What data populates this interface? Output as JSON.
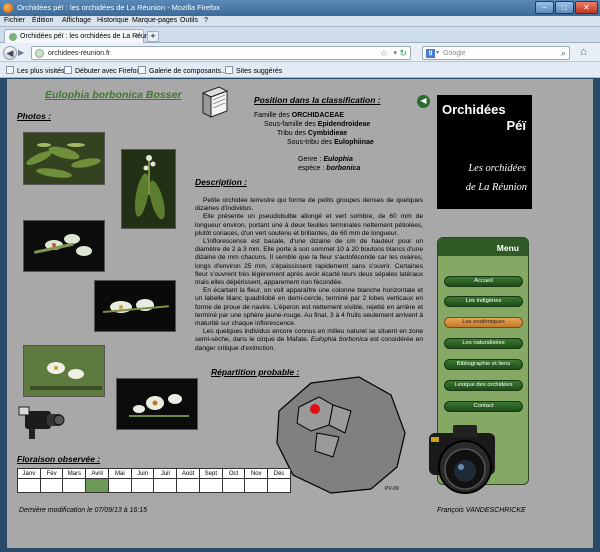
{
  "window": {
    "title": "Orchidées péï : les orchidées de La Réunion - Mozilla Firefox",
    "min": "‒",
    "max": "□",
    "close": "✕"
  },
  "menubar": [
    "Fichier",
    "Édition",
    "Affichage",
    "Historique",
    "Marque-pages",
    "Outils",
    "?"
  ],
  "tab": {
    "title": "Orchidées péï : les orchidées de La Réuni...",
    "close": "×",
    "new": "+"
  },
  "nav": {
    "back": "◀",
    "forward": "▶",
    "url": "orchidees-reunion.fr",
    "search_placeholder": "Google",
    "search_engine": "g",
    "home": "⌂"
  },
  "bookmarks": [
    "Les plus visités",
    "Débuter avec Firefox",
    "Galerie de composants...",
    "Sites suggérés"
  ],
  "page": {
    "latin_name": "Eulophia borbonica Bosser",
    "photos_heading": "Photos :",
    "classification_heading": "Position dans la classification :",
    "classification": {
      "famille_label": "Famille des",
      "famille": "ORCHIDACEAE",
      "sous_famille_label": "Sous-famille des",
      "sous_famille": "Epidendroideae",
      "tribu_label": "Tribu des",
      "tribu": "Cymbidieae",
      "sous_tribu_label": "Sous-tribu des",
      "sous_tribu": "Eulophiinae",
      "genre_label": "Genre :",
      "genre": "Eulophia",
      "espece_label": "espèce :",
      "espece": "borbonica"
    },
    "description_heading": "Description :",
    "description": [
      "Petite orchidée terrestre qui forme de petits groupes denses de quelques dizaines d'individus.",
      "Elle présente un pseudobulbe allongé et vert sombre, de 60 mm de longueur environ, portant une à deux feuilles terminales nettement pétiolées, plutôt coriaces, d'un vert soutenu et brillantes, de 60 mm de longueur.",
      "L'inflorescence est basale, d'une dizaine de cm de hauteur pour un diamètre de 2 à 3 mm. Elle porte à son sommet 10 à 20 boutons blancs d'une dizaine de mm chacuns. Il semble que la fleur s'autoféconde car les ovaires, longs d'environ 25 mm, s'épaississent rapidement sans s'ouvrir. Certaines fleur s'ouvrent très légèrement après avoir écarté leurs deux sépales latéraux mais elles dépérissent, apparement non fécondée.",
      "En écartant la fleur, on voit apparaître une colonne blanche horizontale et un labelle blanc quadrilobé en demi-cercle, terminé par 2 lobes verticaux en forme de proue de navire. L'éperon est nettement visible, rejetté en arrière et terminé par une sphère jaune-rouge. Au final, 3 à 4 fruits seulement arrivent à maturité sur chaque inflorescence.",
      "Les quelques individus encore connus en milieu naturel se situent en zone semi-sèche, dans le cirque de Mafate."
    ],
    "description_end_prefix": "Eulophia borbonica",
    "description_end": " est considérée en danger critique d'extinction.",
    "repartition_heading": "Répartition probable :",
    "map_credit": "PV-09",
    "floraison_heading": "Floraison observée :",
    "months": [
      "Janv",
      "Fév",
      "Mars",
      "Avril",
      "Mai",
      "Juin",
      "Juil",
      "Août",
      "Sept",
      "Oct",
      "Nov",
      "Déc"
    ],
    "flowering_months": [
      "Avril"
    ],
    "last_modified": "Dernière modification le 07/09/13 à 16:15",
    "author": "François VANDESCHRICKE"
  },
  "brand": {
    "line1": "Orchidées",
    "line2": "Péï",
    "line3": "Les orchidées",
    "line4": "de La Réunion",
    "back_arrow": "◀"
  },
  "menu": {
    "title": "Menu",
    "items": [
      "Accueil",
      "Les indigènes",
      "Les endémiques",
      "Les naturalisées",
      "Bibliographie et liens",
      "Lexique des orchidées",
      "Contact"
    ],
    "active": "Les endémiques"
  },
  "colors": {
    "accent_green": "#3f7a2e",
    "menu_active": "#e8a857",
    "page_bg": "#a8a8a8"
  }
}
